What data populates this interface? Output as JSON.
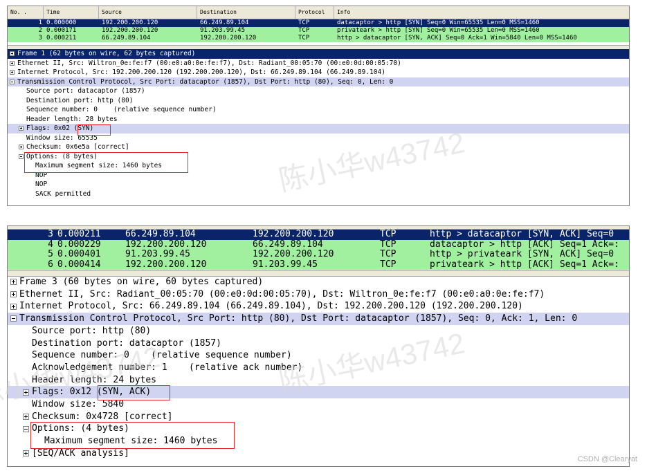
{
  "top": {
    "columns": [
      "No. .",
      "Time",
      "Source",
      "Destination",
      "Protocol",
      "Info"
    ],
    "packets": [
      {
        "no": "1",
        "time": "0.000000",
        "src": "192.200.200.120",
        "dst": "66.249.89.104",
        "proto": "TCP",
        "info": "datacaptor > http [SYN] Seq=0 Win=65535 Len=0 MSS=1460",
        "selected": true
      },
      {
        "no": "2",
        "time": "0.000171",
        "src": "192.200.200.120",
        "dst": "91.203.99.45",
        "proto": "TCP",
        "info": "privateark > http [SYN] Seq=0 Win=65535 Len=0 MSS=1460",
        "selected": false
      },
      {
        "no": "3",
        "time": "0.000211",
        "src": "66.249.89.104",
        "dst": "192.200.200.120",
        "proto": "TCP",
        "info": "http > datacaptor [SYN, ACK] Seq=0 Ack=1 Win=5840 Len=0 MSS=1460",
        "selected": false
      }
    ],
    "details": [
      {
        "text": "Frame 1 (62 bytes on wire, 62 bytes captured)",
        "indent": 0,
        "expander": "plus",
        "style": "selected"
      },
      {
        "text": "Ethernet II, Src: Wiltron_0e:fe:f7 (00:e0:a0:0e:fe:f7), Dst: Radiant_00:05:70 (00:e0:0d:00:05:70)",
        "indent": 0,
        "expander": "plus",
        "style": "normal"
      },
      {
        "text": "Internet Protocol, Src: 192.200.200.120 (192.200.200.120), Dst: 66.249.89.104 (66.249.89.104)",
        "indent": 0,
        "expander": "plus",
        "style": "normal"
      },
      {
        "text": "Transmission Control Protocol, Src Port: datacaptor (1857), Dst Port: http (80), Seq: 0, Len: 0",
        "indent": 0,
        "expander": "minus",
        "style": "highlight"
      },
      {
        "text": "Source port: datacaptor (1857)",
        "indent": 1,
        "expander": "none",
        "style": "normal"
      },
      {
        "text": "Destination port: http (80)",
        "indent": 1,
        "expander": "none",
        "style": "normal"
      },
      {
        "text": "Sequence number: 0    (relative sequence number)",
        "indent": 1,
        "expander": "none",
        "style": "normal"
      },
      {
        "text": "Header length: 28 bytes",
        "indent": 1,
        "expander": "none",
        "style": "normal"
      },
      {
        "text": "Flags: 0x02 (SYN)",
        "indent": 1,
        "expander": "plus",
        "style": "highlight"
      },
      {
        "text": "Window size: 65535",
        "indent": 1,
        "expander": "none",
        "style": "normal"
      },
      {
        "text": "Checksum: 0x6e5a [correct]",
        "indent": 1,
        "expander": "plus",
        "style": "normal"
      },
      {
        "text": "Options: (8 bytes)",
        "indent": 1,
        "expander": "minus",
        "style": "normal"
      },
      {
        "text": "Maximum segment size: 1460 bytes",
        "indent": 2,
        "expander": "none",
        "style": "normal"
      },
      {
        "text": "NOP",
        "indent": 2,
        "expander": "none",
        "style": "normal"
      },
      {
        "text": "NOP",
        "indent": 2,
        "expander": "none",
        "style": "normal"
      },
      {
        "text": "SACK permitted",
        "indent": 2,
        "expander": "none",
        "style": "normal"
      }
    ]
  },
  "bottom": {
    "packets": [
      {
        "no": "3",
        "time": "0.000211",
        "src": "66.249.89.104",
        "dst": "192.200.200.120",
        "proto": "TCP",
        "info": "http > datacaptor [SYN, ACK] Seq=0",
        "selected": true
      },
      {
        "no": "4",
        "time": "0.000229",
        "src": "192.200.200.120",
        "dst": "66.249.89.104",
        "proto": "TCP",
        "info": "datacaptor > http [ACK] Seq=1 Ack=:",
        "selected": false
      },
      {
        "no": "5",
        "time": "0.000401",
        "src": "91.203.99.45",
        "dst": "192.200.200.120",
        "proto": "TCP",
        "info": "http > privateark [SYN, ACK] Seq=0",
        "selected": false
      },
      {
        "no": "6",
        "time": "0.000414",
        "src": "192.200.200.120",
        "dst": "91.203.99.45",
        "proto": "TCP",
        "info": "privateark > http [ACK] Seq=1 Ack=:",
        "selected": false
      }
    ],
    "details": [
      {
        "text": "Frame 3 (60 bytes on wire, 60 bytes captured)",
        "indent": 0,
        "expander": "plus",
        "style": "normal"
      },
      {
        "text": "Ethernet II, Src: Radiant_00:05:70 (00:e0:0d:00:05:70), Dst: Wiltron_0e:fe:f7 (00:e0:a0:0e:fe:f7)",
        "indent": 0,
        "expander": "plus",
        "style": "normal"
      },
      {
        "text": "Internet Protocol, Src: 66.249.89.104 (66.249.89.104), Dst: 192.200.200.120 (192.200.200.120)",
        "indent": 0,
        "expander": "plus",
        "style": "normal"
      },
      {
        "text": "Transmission Control Protocol, Src Port: http (80), Dst Port: datacaptor (1857), Seq: 0, Ack: 1, Len: 0",
        "indent": 0,
        "expander": "minus",
        "style": "highlight"
      },
      {
        "text": "Source port: http (80)",
        "indent": 1,
        "expander": "none",
        "style": "normal"
      },
      {
        "text": "Destination port: datacaptor (1857)",
        "indent": 1,
        "expander": "none",
        "style": "normal"
      },
      {
        "text": "Sequence number: 0    (relative sequence number)",
        "indent": 1,
        "expander": "none",
        "style": "normal"
      },
      {
        "text": "Acknowledgement number: 1    (relative ack number)",
        "indent": 1,
        "expander": "none",
        "style": "normal"
      },
      {
        "text": "Header length: 24 bytes",
        "indent": 1,
        "expander": "none",
        "style": "normal"
      },
      {
        "text": "Flags: 0x12 (SYN, ACK)",
        "indent": 1,
        "expander": "plus",
        "style": "highlight"
      },
      {
        "text": "Window size: 5840",
        "indent": 1,
        "expander": "none",
        "style": "normal"
      },
      {
        "text": "Checksum: 0x4728 [correct]",
        "indent": 1,
        "expander": "plus",
        "style": "normal"
      },
      {
        "text": "Options: (4 bytes)",
        "indent": 1,
        "expander": "minus",
        "style": "normal"
      },
      {
        "text": "Maximum segment size: 1460 bytes",
        "indent": 2,
        "expander": "none",
        "style": "normal"
      },
      {
        "text": "[SEQ/ACK analysis]",
        "indent": 1,
        "expander": "plus",
        "style": "normal"
      }
    ]
  },
  "watermark": "陈小华w43742",
  "credit": "CSDN @Clearyat",
  "colors": {
    "selected_bg": "#0a246a",
    "selected_fg": "#ffffff",
    "tcp_row_bg": "#a0f0a0",
    "highlight_bg": "#d0d4f0",
    "annotation": "#e8262a"
  }
}
